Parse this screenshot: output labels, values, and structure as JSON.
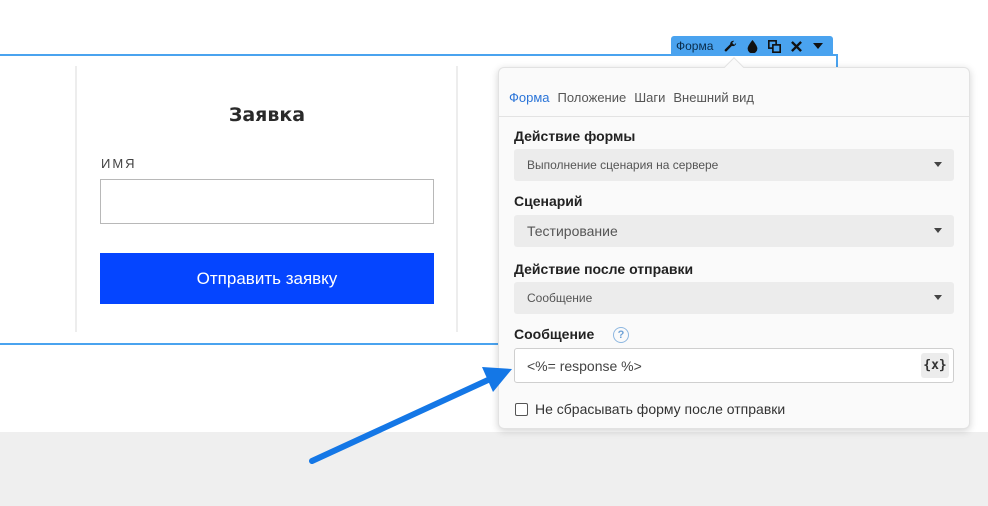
{
  "form_block": {
    "title": "Заявка",
    "name_label": "ИМЯ",
    "name_value": "",
    "submit_label": "Отправить заявку"
  },
  "toolbar": {
    "label": "Форма",
    "icons": [
      "wrench-icon",
      "drop-icon",
      "duplicate-icon",
      "close-icon",
      "caret-down-icon"
    ]
  },
  "panel": {
    "tabs": [
      {
        "label": "Форма",
        "active": true
      },
      {
        "label": "Положение",
        "active": false
      },
      {
        "label": "Шаги",
        "active": false
      },
      {
        "label": "Внешний вид",
        "active": false
      }
    ],
    "form_action": {
      "label": "Действие формы",
      "value": "Выполнение сценария на сервере"
    },
    "scenario": {
      "label": "Сценарий",
      "value": "Тестирование"
    },
    "after_submit": {
      "label": "Действие после отправки",
      "value": "Сообщение"
    },
    "message": {
      "label": "Сообщение",
      "value": "<%= response %>",
      "var_button": "{x}"
    },
    "no_reset": {
      "label": "Не сбрасывать форму после отправки",
      "checked": false
    }
  },
  "colors": {
    "accent": "#4aa3ef",
    "submit": "#0545ff",
    "arrow": "#1477e6",
    "active_tab": "#2a74d8"
  }
}
